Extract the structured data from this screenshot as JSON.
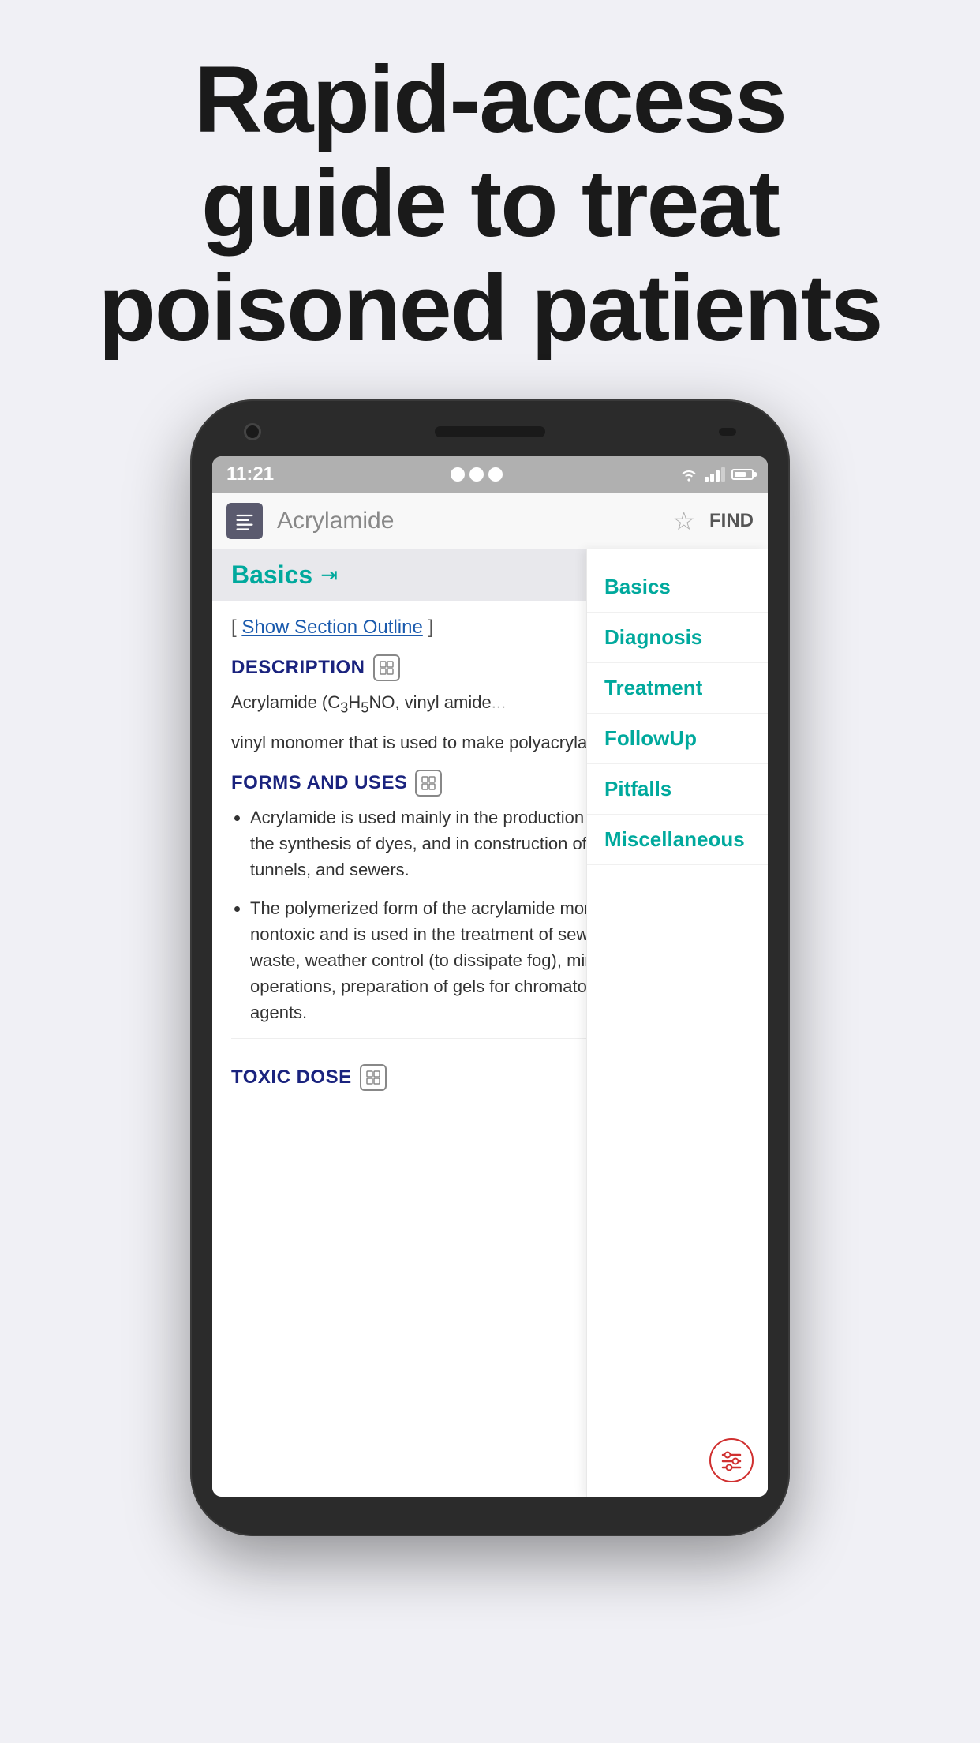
{
  "hero": {
    "title": "Rapid-access guide to treat poisoned patients"
  },
  "phone": {
    "status_bar": {
      "time": "11:21",
      "icons_left": [
        "location",
        "sim",
        "data"
      ],
      "signal": "wifi",
      "battery": "70"
    },
    "nav": {
      "title": "Acrylamide",
      "star_label": "☆",
      "find_label": "FIND"
    },
    "sidebar": {
      "items": [
        {
          "label": "Basics",
          "active": true
        },
        {
          "label": "Diagnosis",
          "active": false
        },
        {
          "label": "Treatment",
          "active": false
        },
        {
          "label": "FollowUp",
          "active": false
        },
        {
          "label": "Pitfalls",
          "active": false
        },
        {
          "label": "Miscellaneous",
          "active": false
        }
      ]
    },
    "content": {
      "section_label": "Basics",
      "show_outline_prefix": "[ ",
      "show_outline_link": "Show Section Outline",
      "show_outline_suffix": " ]",
      "description_header": "DESCRIPTION",
      "description_text": "Acrylamide (C₃H₅NO, vinyl amide...",
      "description_text2": "vinyl monomer that is used to make polyacrylamide.",
      "forms_uses_header": "FORMS AND USES",
      "bullet_items": [
        "Acrylamide is used mainly in the production of polyacrylamide, in the synthesis of dyes, and in construction of dam foundations, tunnels, and sewers.",
        "The polymerized form of the acrylamide monomer is relatively nontoxic and is used in the treatment of sewage and industrial waste, weather control (to dissipate fog), mining and timber operations, preparation of gels for chromatography, and grouting agents."
      ],
      "toxic_dose_header": "TOXIC DOSE"
    }
  }
}
